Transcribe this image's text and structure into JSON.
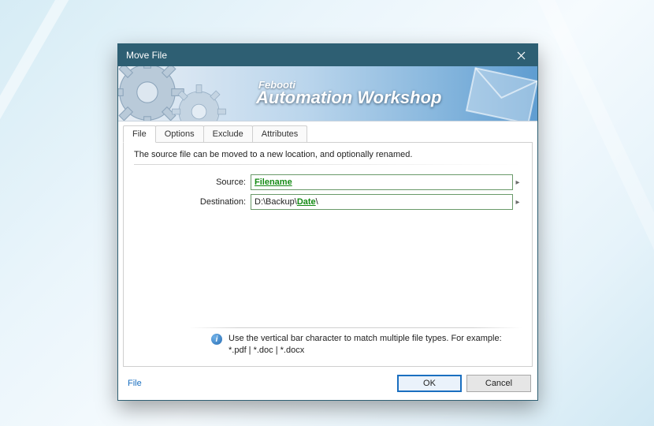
{
  "window": {
    "title": "Move File"
  },
  "banner": {
    "brand": "Febooti",
    "product": "Automation Workshop"
  },
  "tabs": [
    "File",
    "Options",
    "Exclude",
    "Attributes"
  ],
  "activeTab": "File",
  "panel": {
    "description": "The source file can be moved to a new location, and optionally renamed.",
    "rows": {
      "source": {
        "label": "Source:",
        "var": "Filename"
      },
      "destination": {
        "label": "Destination:",
        "prefix": "D:\\Backup\\",
        "var": "Date",
        "suffix": "\\"
      }
    },
    "hint": {
      "line1": "Use the vertical bar character to match multiple file types. For example:",
      "line2": "*.pdf | *.doc | *.docx"
    }
  },
  "buttons": {
    "help": "File",
    "ok": "OK",
    "cancel": "Cancel"
  }
}
